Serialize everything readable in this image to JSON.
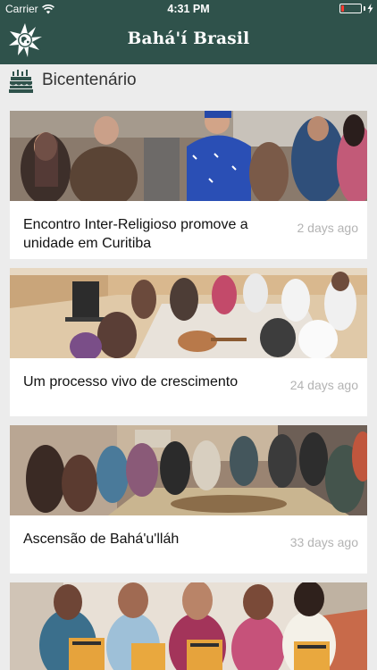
{
  "status_bar": {
    "carrier": "Carrier",
    "time": "4:31 PM"
  },
  "app": {
    "title": "Bahá'í Brasil"
  },
  "section": {
    "title": "Bicentenário",
    "icon": "cake-icon"
  },
  "articles": [
    {
      "title": "Encontro Inter-Religioso promove a unidade em Curitiba",
      "age": "2 days ago"
    },
    {
      "title": "Um processo vivo de crescimento",
      "age": "24 days ago"
    },
    {
      "title": "Ascensão de Bahá'u'lláh",
      "age": "33 days ago"
    },
    {
      "title": "",
      "age": ""
    }
  ],
  "icons": {
    "logo": "bahai-star-globe-icon",
    "wifi": "wifi-icon",
    "battery": "battery-icon",
    "charging": "charging-bolt-icon"
  },
  "colors": {
    "nav_background": "#2f524b",
    "page_background": "#ececec",
    "timestamp_text": "#b3b3b3",
    "battery_low": "#ff3b30"
  },
  "battery_level": 0.12
}
